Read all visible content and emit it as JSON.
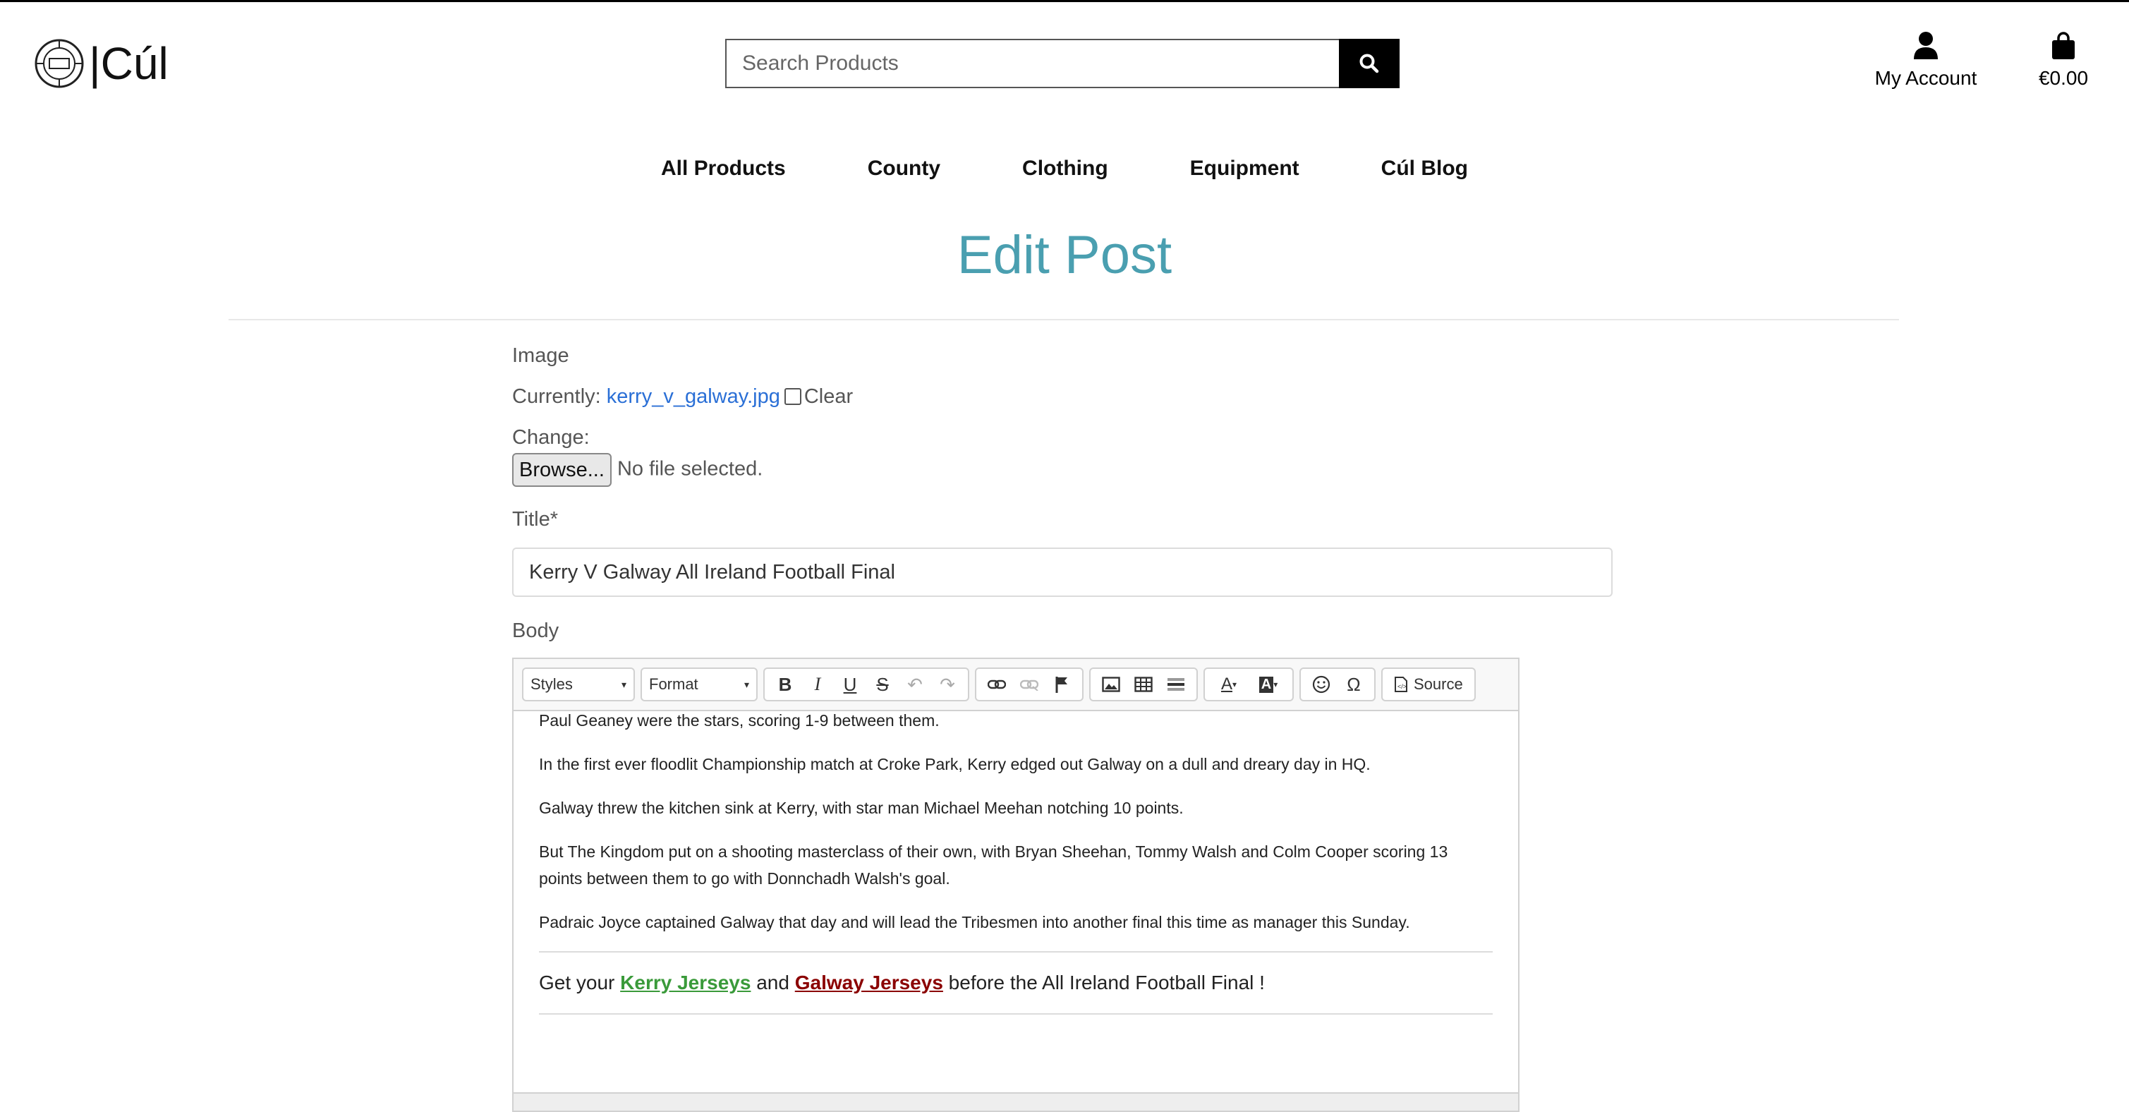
{
  "header": {
    "logo_text": "|Cúl",
    "search_placeholder": "Search Products",
    "account_label": "My Account",
    "cart_total": "€0.00"
  },
  "nav": {
    "items": [
      "All Products",
      "County",
      "Clothing",
      "Equipment",
      "Cúl Blog"
    ]
  },
  "page": {
    "title": "Edit Post"
  },
  "form": {
    "image_label": "Image",
    "currently_label": "Currently:",
    "current_file": "kerry_v_galway.jpg",
    "clear_label": "Clear",
    "change_label": "Change:",
    "browse_button": "Browse...",
    "no_file_text": "No file selected.",
    "title_label": "Title*",
    "title_value": "Kerry V Galway All Ireland Football Final",
    "body_label": "Body"
  },
  "editor": {
    "styles_label": "Styles",
    "format_label": "Format",
    "source_label": "Source",
    "paragraphs": [
      "Paul Geaney were the stars, scoring 1-9 between them.",
      "In the first ever floodlit Championship match at Croke Park, Kerry edged out Galway on a dull and dreary day in HQ.",
      "Galway threw the kitchen sink at Kerry, with star man Michael Meehan notching 10 points.",
      "But The Kingdom put on a shooting masterclass of their own, with Bryan Sheehan, Tommy Walsh and Colm Cooper scoring 13 points between them to go with Donnchadh Walsh's goal.",
      "Padraic Joyce captained Galway that day and will lead the Tribesmen into another final this time as manager this Sunday."
    ],
    "cta": {
      "prefix": "Get your ",
      "kerry_link": "Kerry Jerseys",
      "middle": " and ",
      "galway_link": "Galway Jerseys",
      "suffix": " before the All Ireland Football Final !"
    },
    "colors": {
      "kerry": "#3a9a3a",
      "galway": "#8b0000"
    }
  },
  "colors": {
    "title": "#4a9fb0",
    "link": "#2a6fd6"
  }
}
